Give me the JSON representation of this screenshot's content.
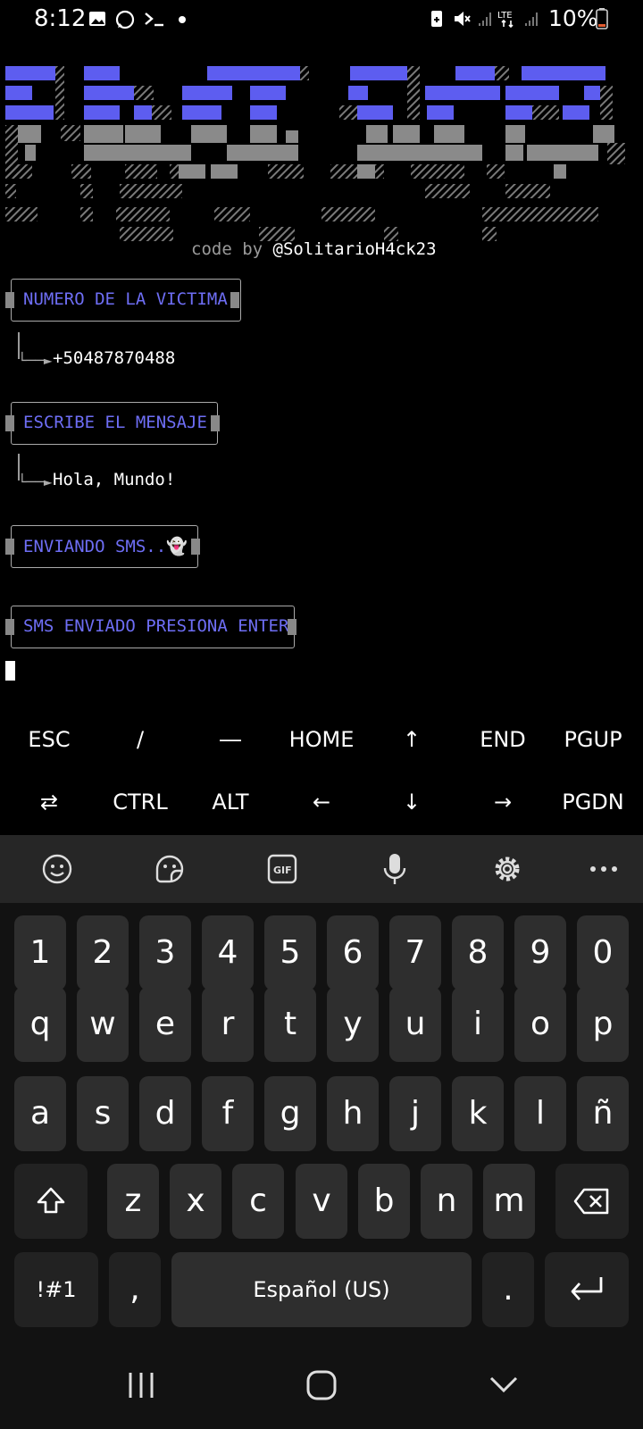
{
  "status_bar": {
    "time": "8:12",
    "battery": "10%",
    "icons": [
      "image-icon",
      "whatsapp-icon",
      "terminal-icon",
      "dot-icon",
      "battery-saver-icon",
      "mute-icon",
      "signal-icon",
      "lte-icon",
      "signal-icon",
      "battery-icon"
    ]
  },
  "banner": {
    "credit_prefix": "code by ",
    "credit_handle": "@SolitarioH4ck23",
    "accent_color": "#5d5df0"
  },
  "terminal": {
    "prompt_number": "NUMERO DE LA VICTIMA",
    "number_value": "+50487870488",
    "prompt_message": "ESCRIBE EL MENSAJE",
    "message_value": "Hola, Mundo!",
    "status_sending": "ENVIANDO SMS..",
    "status_sent": "SMS ENVIADO PRESIONA ENTER"
  },
  "extra_keys": {
    "row1": [
      "ESC",
      "/",
      "―",
      "HOME",
      "↑",
      "END",
      "PGUP"
    ],
    "row2": [
      "⇄",
      "CTRL",
      "ALT",
      "←",
      "↓",
      "→",
      "PGDN"
    ]
  },
  "keyboard": {
    "toolbar_icons": [
      "emoji-icon",
      "sticker-icon",
      "gif-icon",
      "microphone-icon",
      "settings-icon",
      "more-icon"
    ],
    "numbers": [
      "1",
      "2",
      "3",
      "4",
      "5",
      "6",
      "7",
      "8",
      "9",
      "0"
    ],
    "row_q": [
      "q",
      "w",
      "e",
      "r",
      "t",
      "y",
      "u",
      "i",
      "o",
      "p"
    ],
    "row_a": [
      "a",
      "s",
      "d",
      "f",
      "g",
      "h",
      "j",
      "k",
      "l",
      "ñ"
    ],
    "row_z": [
      "z",
      "x",
      "c",
      "v",
      "b",
      "n",
      "m"
    ],
    "symbols_key": "!#1",
    "comma_key": ",",
    "space_label": "Español (US)",
    "period_key": "."
  }
}
